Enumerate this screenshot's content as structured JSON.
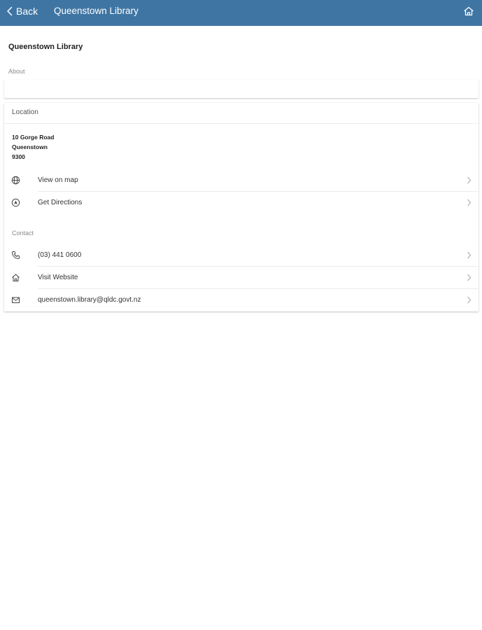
{
  "header": {
    "back_label": "Back",
    "title": "Queenstown Library",
    "home_icon": "home-icon"
  },
  "page": {
    "title": "Queenstown Library",
    "about_label": "About"
  },
  "location": {
    "header": "Location",
    "address": [
      "10 Gorge Road",
      "Queenstown",
      "9300"
    ],
    "actions": [
      {
        "label": "View on map",
        "icon": "globe-icon"
      },
      {
        "label": "Get Directions",
        "icon": "directions-icon"
      }
    ]
  },
  "contact": {
    "label": "Contact",
    "items": [
      {
        "label": "(03) 441 0600",
        "icon": "phone-icon"
      },
      {
        "label": "Visit Website",
        "icon": "home-icon"
      },
      {
        "label": "queenstown.library@qldc.govt.nz",
        "icon": "mail-icon"
      }
    ]
  },
  "colors": {
    "header_bg": "#3f75a3",
    "header_text": "#ffffff",
    "divider": "#ececec"
  }
}
